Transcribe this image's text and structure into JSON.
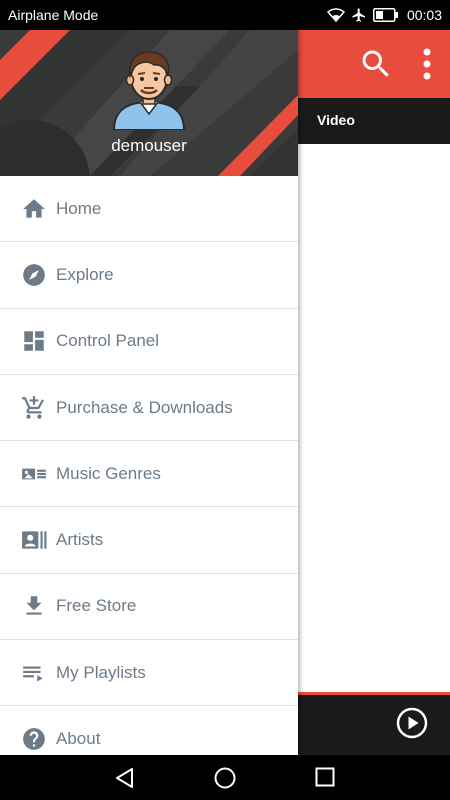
{
  "status_bar": {
    "mode": "Airplane Mode",
    "time": "00:03",
    "icons": [
      "wifi-icon",
      "airplane-icon",
      "battery-icon"
    ]
  },
  "app": {
    "toolbar_color": "#e84c3d",
    "tab_label": "Video",
    "actions": [
      "search-icon",
      "more-vert-icon"
    ],
    "player": {
      "play_icon": "play-circle-icon"
    }
  },
  "drawer": {
    "username": "demouser",
    "avatar_icon": "user-avatar-icon",
    "items": [
      {
        "label": "Home",
        "icon": "home-icon"
      },
      {
        "label": "Explore",
        "icon": "compass-icon"
      },
      {
        "label": "Control Panel",
        "icon": "dashboard-icon"
      },
      {
        "label": "Purchase & Downloads",
        "icon": "add-shopping-cart-icon"
      },
      {
        "label": "Music Genres",
        "icon": "genres-icon"
      },
      {
        "label": "Artists",
        "icon": "contacts-icon"
      },
      {
        "label": "Free Store",
        "icon": "download-icon"
      },
      {
        "label": "My Playlists",
        "icon": "playlist-icon"
      },
      {
        "label": "About",
        "icon": "help-icon"
      }
    ]
  },
  "nav_bar": {
    "buttons": [
      "back-icon",
      "home-circle-icon",
      "recents-icon"
    ]
  },
  "colors": {
    "accent": "#e84c3d",
    "menu_text": "#6d7b88",
    "header_bg": "#3c3c3c"
  }
}
